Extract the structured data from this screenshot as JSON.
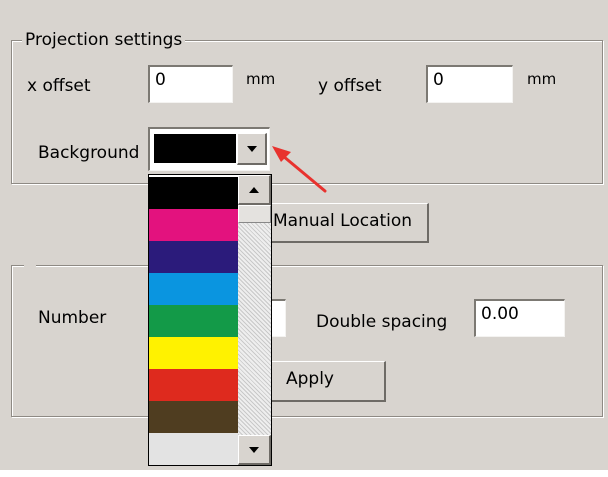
{
  "projection": {
    "title": "Projection settings",
    "x_offset_label": "x offset",
    "x_offset_value": "0",
    "x_unit": "mm",
    "y_offset_label": "y offset",
    "y_offset_value": "0",
    "y_unit": "mm",
    "background_label": "Background",
    "background_selected": "#000000",
    "manual_location_label": "Manual Location"
  },
  "numbering": {
    "number_label": "Number",
    "double_spacing_label": "Double spacing",
    "double_spacing_value": "0.00",
    "apply_label": "Apply"
  },
  "color_options": [
    {
      "name": "black",
      "color": "#000000"
    },
    {
      "name": "magenta",
      "color": "#e3127e"
    },
    {
      "name": "indigo",
      "color": "#2b1b7b"
    },
    {
      "name": "sky-blue",
      "color": "#0a95e0"
    },
    {
      "name": "green",
      "color": "#139a48"
    },
    {
      "name": "yellow",
      "color": "#fff200"
    },
    {
      "name": "red",
      "color": "#de2a1e"
    },
    {
      "name": "brown",
      "color": "#4f3d20"
    },
    {
      "name": "light-gray",
      "color": "#e3e3e3"
    }
  ],
  "annotation": {
    "arrow_color": "#e8322e"
  },
  "theme": {
    "panel_background": "#d8d4cf"
  }
}
